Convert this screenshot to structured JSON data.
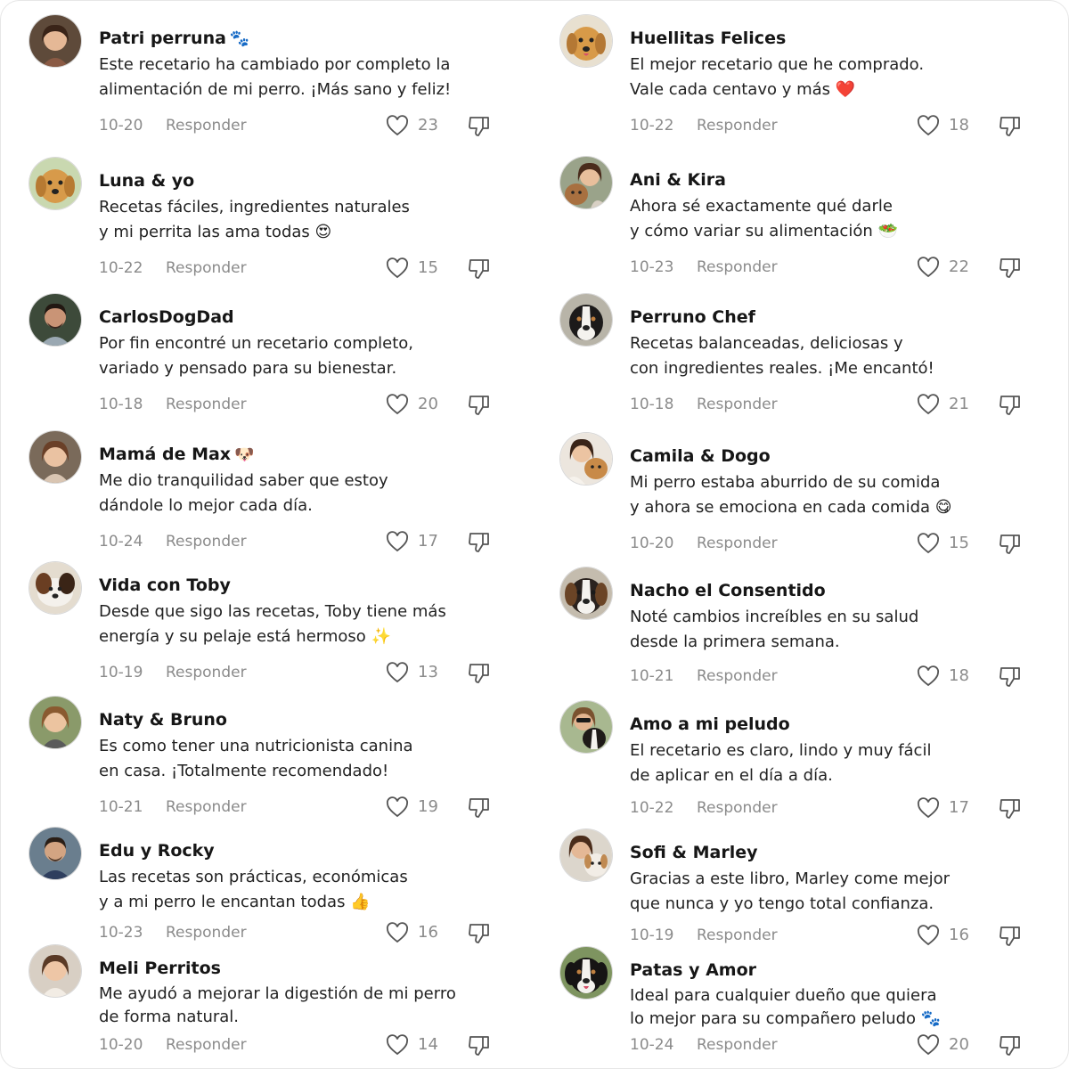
{
  "colors": {
    "text": "#1a1a1a",
    "muted": "#8b8b8b",
    "icon": "#555555",
    "heart_emoji": "#e0202a"
  },
  "left": [
    {
      "name": "Patri perruna",
      "emoji": "🐾",
      "lines": [
        "Este recetario ha cambiado por completo la",
        "alimentación de mi perro. ¡Más sano y feliz!"
      ],
      "date": "10-20",
      "reply": "Responder",
      "likes": "23",
      "avatar": "woman-avatar"
    },
    {
      "name": "Luna & yo",
      "emoji": "",
      "lines": [
        "Recetas fáciles, ingredientes naturales",
        "y mi perrita las ama todas 😍"
      ],
      "date": "10-22",
      "reply": "Responder",
      "likes": "15",
      "avatar": "golden-dog-avatar"
    },
    {
      "name": "CarlosDogDad",
      "emoji": "",
      "lines": [
        "Por fin encontré un recetario completo,",
        "variado y pensado para su bienestar."
      ],
      "date": "10-18",
      "reply": "Responder",
      "likes": "20",
      "avatar": "man-avatar"
    },
    {
      "name": "Mamá de Max",
      "emoji": "🐶",
      "lines": [
        "Me dio tranquilidad saber que estoy",
        "dándole lo mejor cada día."
      ],
      "date": "10-24",
      "reply": "Responder",
      "likes": "17",
      "avatar": "woman-avatar"
    },
    {
      "name": "Vida con Toby",
      "emoji": "",
      "lines": [
        "Desde que sigo las recetas, Toby tiene más",
        "energía y su pelaje está hermoso ✨"
      ],
      "date": "10-19",
      "reply": "Responder",
      "likes": "13",
      "avatar": "puppy-avatar"
    },
    {
      "name": "Naty & Bruno",
      "emoji": "",
      "lines": [
        "Es como tener una nutricionista canina",
        "en casa. ¡Totalmente recomendado!"
      ],
      "date": "10-21",
      "reply": "Responder",
      "likes": "19",
      "avatar": "woman-avatar"
    },
    {
      "name": "Edu y Rocky",
      "emoji": "",
      "lines": [
        "Las recetas son prácticas, económicas",
        "y a mi perro le encantan todas 👍"
      ],
      "date": "10-23",
      "reply": "Responder",
      "likes": "16",
      "avatar": "man-avatar"
    },
    {
      "name": "Meli Perritos",
      "emoji": "",
      "lines": [
        "Me ayudó a mejorar la digestión de mi perro",
        "de forma natural."
      ],
      "date": "10-20",
      "reply": "Responder",
      "likes": "14",
      "avatar": "woman-avatar"
    }
  ],
  "right": [
    {
      "name": "Huellitas Felices",
      "emoji": "",
      "lines": [
        "El mejor recetario que he comprado.",
        "Vale cada centavo y más ❤️"
      ],
      "date": "10-22",
      "reply": "Responder",
      "likes": "18",
      "avatar": "golden-dog-avatar"
    },
    {
      "name": "Ani & Kira",
      "emoji": "",
      "lines": [
        "Ahora sé exactamente qué darle",
        "y cómo variar su alimentación 🥗"
      ],
      "date": "10-23",
      "reply": "Responder",
      "likes": "22",
      "avatar": "woman-dog-avatar"
    },
    {
      "name": "Perruno Chef",
      "emoji": "",
      "lines": [
        "Recetas balanceadas, deliciosas y",
        "con ingredientes reales. ¡Me encantó!"
      ],
      "date": "10-18",
      "reply": "Responder",
      "likes": "21",
      "avatar": "tricolor-dog-avatar"
    },
    {
      "name": "Camila & Dogo",
      "emoji": "",
      "lines": [
        "Mi perro estaba aburrido de su comida",
        "y ahora se emociona en cada comida 😋"
      ],
      "date": "10-20",
      "reply": "Responder",
      "likes": "15",
      "avatar": "woman-dog-avatar"
    },
    {
      "name": "Nacho el Consentido",
      "emoji": "",
      "lines": [
        "Noté cambios increíbles en su salud",
        "desde la primera semana."
      ],
      "date": "10-21",
      "reply": "Responder",
      "likes": "18",
      "avatar": "tricolor-dog-avatar"
    },
    {
      "name": "Amo a mi peludo",
      "emoji": "",
      "lines": [
        "El recetario es claro, lindo y muy fácil",
        "de aplicar en el día a día."
      ],
      "date": "10-22",
      "reply": "Responder",
      "likes": "17",
      "avatar": "woman-dog-avatar"
    },
    {
      "name": "Sofi & Marley",
      "emoji": "",
      "lines": [
        "Gracias a este libro, Marley come mejor",
        "que nunca y yo tengo total confianza."
      ],
      "date": "10-19",
      "reply": "Responder",
      "likes": "16",
      "avatar": "woman-dog-avatar"
    },
    {
      "name": "Patas y Amor",
      "emoji": "",
      "lines": [
        "Ideal para cualquier dueño que quiera",
        "lo mejor para su compañero peludo 🐾"
      ],
      "date": "10-24",
      "reply": "Responder",
      "likes": "20",
      "avatar": "tricolor-dog-avatar"
    }
  ]
}
